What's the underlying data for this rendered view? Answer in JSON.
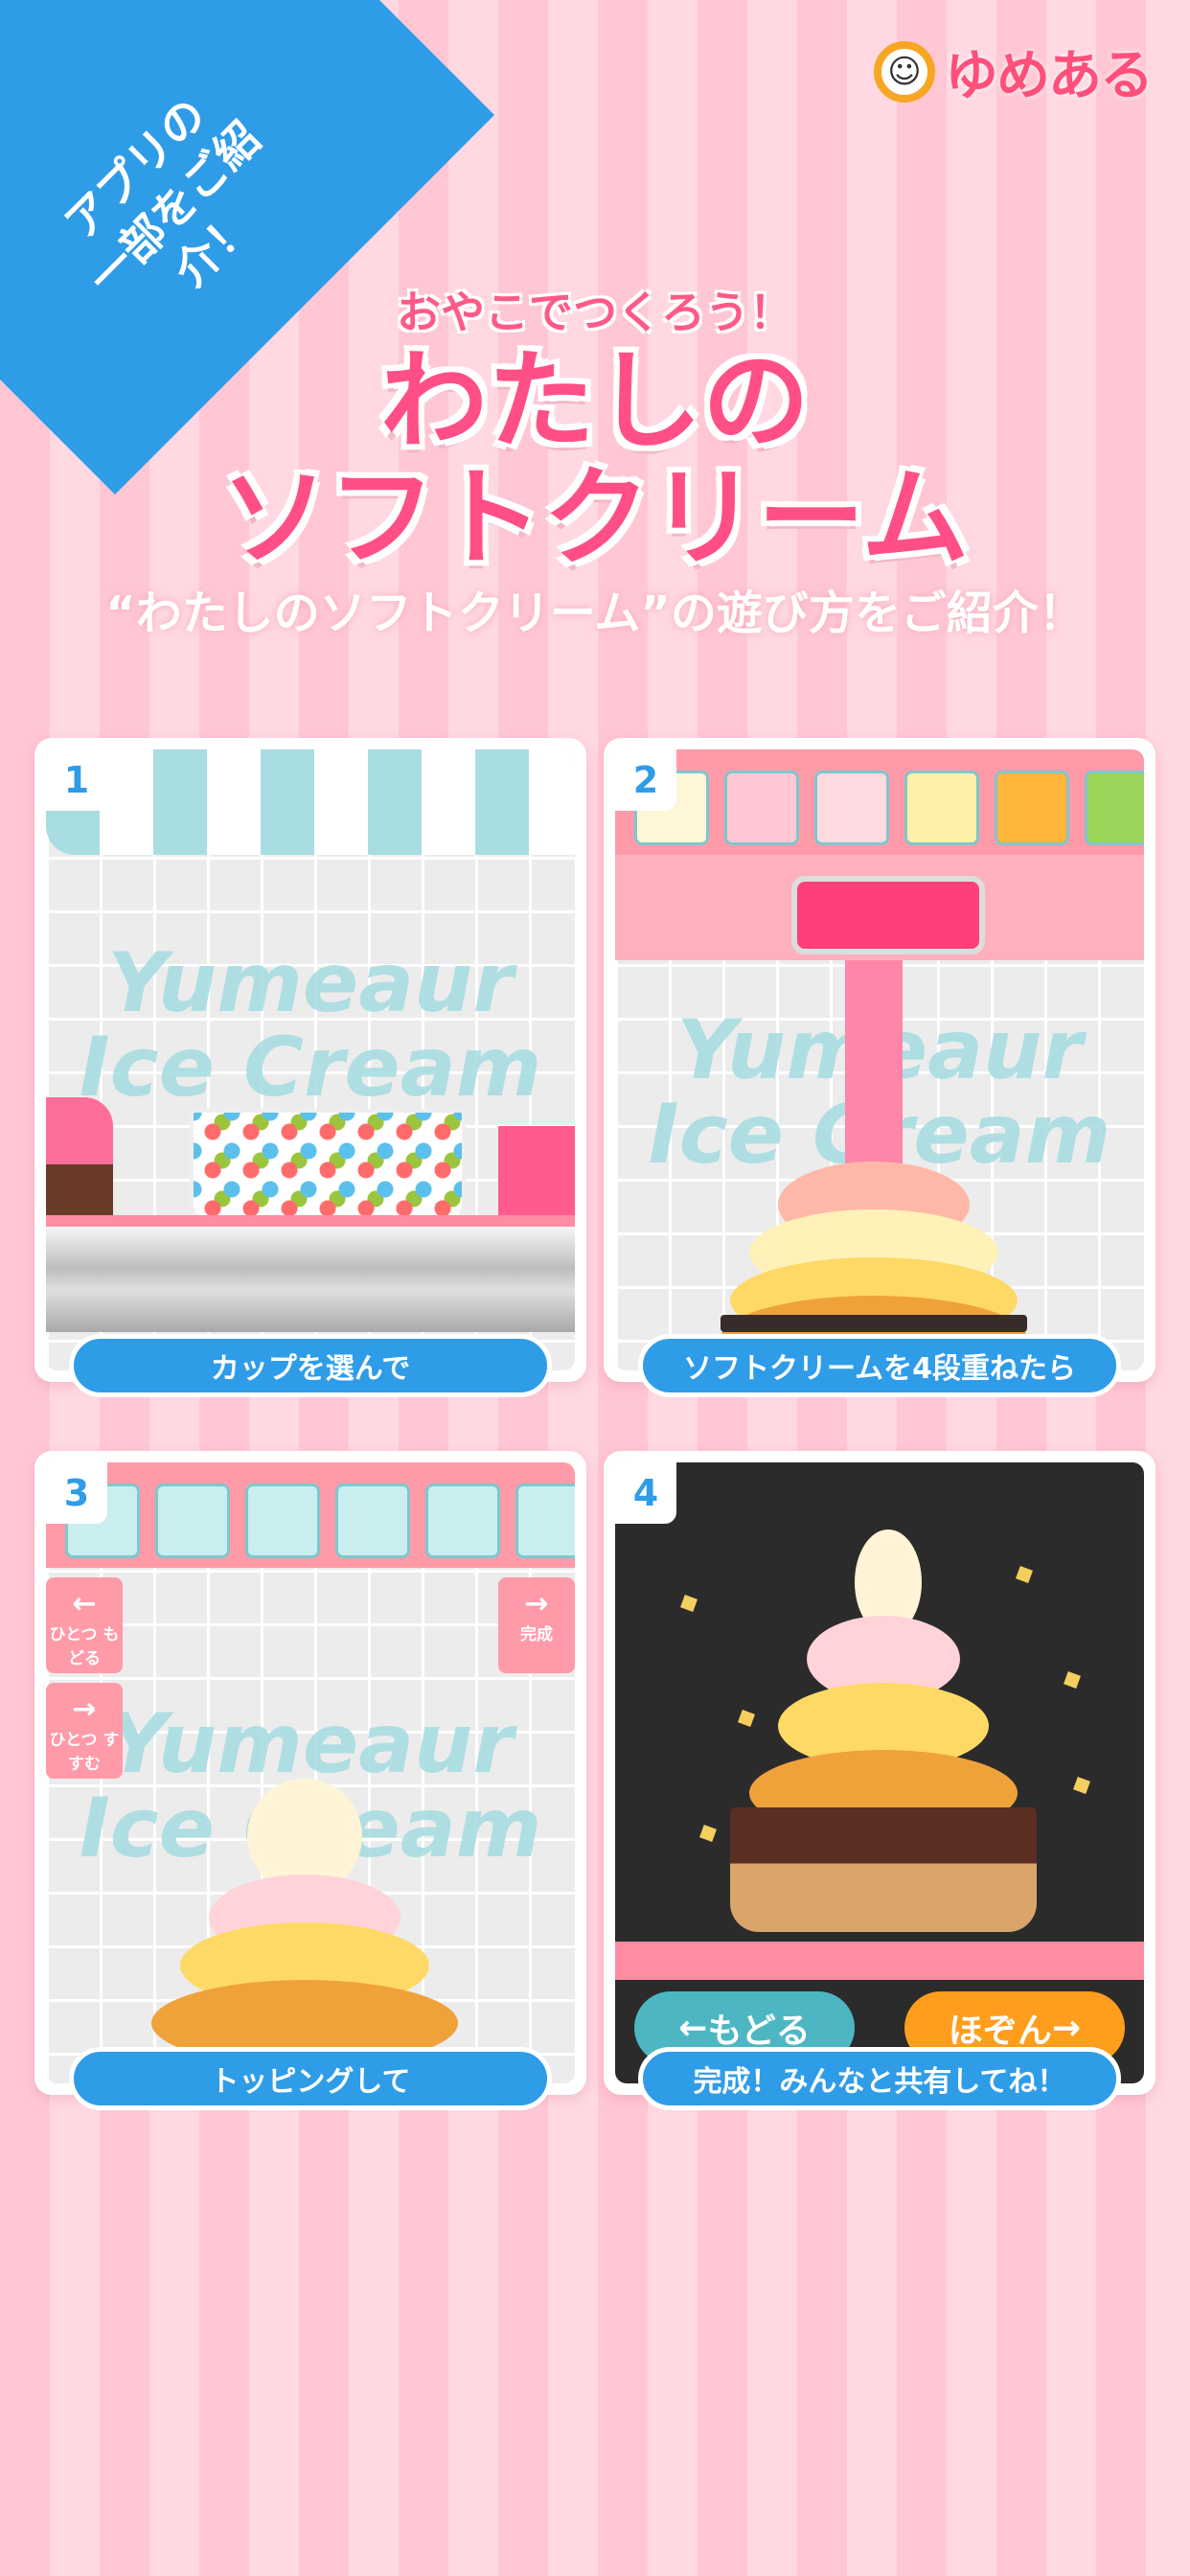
{
  "corner_ribbon": {
    "line1": "アプリの",
    "line2": "一部をご紹介！"
  },
  "logo": {
    "text": "ゆめある",
    "badge_icon": "smiley-face-icon"
  },
  "header": {
    "subtitle": "おやこでつくろう！",
    "title_line1": "わたしの",
    "title_line2": "ソフトクリーム",
    "tagline": "“わたしのソフトクリーム”の遊び方をご紹介！"
  },
  "brand_watermark": {
    "line1": "Yumeaur",
    "line2": "Ice Cream"
  },
  "steps": [
    {
      "number": "1",
      "caption": "カップを選んで"
    },
    {
      "number": "2",
      "caption": "ソフトクリームを4段重ねたら"
    },
    {
      "number": "3",
      "caption": "トッピングして",
      "undo_label": "ひとつ もどる",
      "redo_label": "ひとつ すすむ",
      "done_label": "完成"
    },
    {
      "number": "4",
      "caption": "完成！みんなと共有してね！",
      "back_label": "もどる",
      "save_label": "ほぞん"
    }
  ],
  "colors": {
    "accent_blue": "#2f9ce8",
    "title_pink": "#ff4f86",
    "background_pink": "#ffc7d4"
  }
}
